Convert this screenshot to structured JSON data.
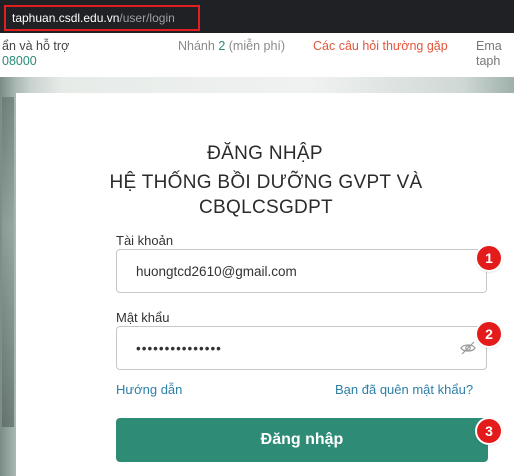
{
  "browser": {
    "url_host": "taphuan.csdl.edu.vn",
    "url_path": "/user/login"
  },
  "info_strip": {
    "support_label": "ẩn và hỗ trợ",
    "support_number": "08000",
    "branch_label": "Nhánh",
    "branch_number": "2",
    "branch_note": "(miễn phí)",
    "faq_label": "Các câu hỏi thường gặp",
    "email_label": "Ema",
    "email_value": "taph"
  },
  "login": {
    "title": "ĐĂNG NHẬP",
    "subtitle": "HỆ THỐNG BỒI DƯỠNG GVPT VÀ CBQLCSGDPT",
    "account_label": "Tài khoản",
    "account_value": "huongtcd2610@gmail.com",
    "password_label": "Mật khẩu",
    "password_value": "•••••••••••••••",
    "guide_link": "Hướng dẫn",
    "forgot_link": "Bạn đã quên mật khẩu?",
    "submit_label": "Đăng nhập"
  },
  "annotations": {
    "step1": "1",
    "step2": "2",
    "step3": "3"
  },
  "colors": {
    "accent": "#2e8b76",
    "link": "#2c7fa8",
    "badge": "#e31b1b",
    "highlight": "#e02020"
  },
  "icons": {
    "password_toggle": "eye-slash-icon"
  }
}
